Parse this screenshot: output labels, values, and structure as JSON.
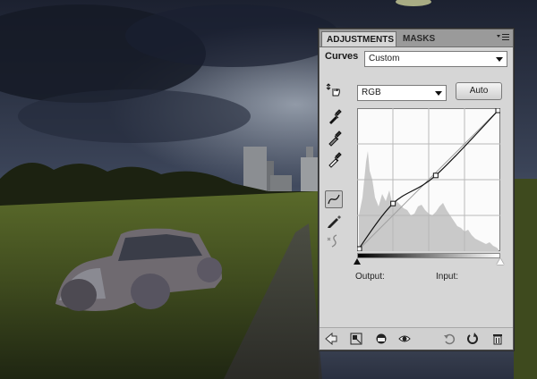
{
  "panel": {
    "tabs": [
      {
        "label": "ADJUSTMENTS"
      },
      {
        "label": "MASKS"
      }
    ],
    "title": "Curves",
    "preset": "Custom",
    "channel": "RGB",
    "auto_label": "Auto",
    "output_label": "Output:",
    "input_label": "Input:"
  },
  "curve": {
    "points": [
      [
        0,
        0
      ],
      [
        64,
        85
      ],
      [
        140,
        135
      ],
      [
        255,
        255
      ]
    ]
  },
  "icons": {
    "tools": [
      "on-image-adjust-icon",
      "black-point-eyedropper-icon",
      "gray-point-eyedropper-icon",
      "white-point-eyedropper-icon",
      "curve-points-icon",
      "pencil-icon",
      "smooth-icon"
    ],
    "bottom": [
      "back-arrow-icon",
      "expand-view-icon",
      "clip-layer-icon",
      "visibility-eye-icon",
      "reset-previous-icon",
      "reset-default-icon",
      "delete-icon"
    ]
  }
}
